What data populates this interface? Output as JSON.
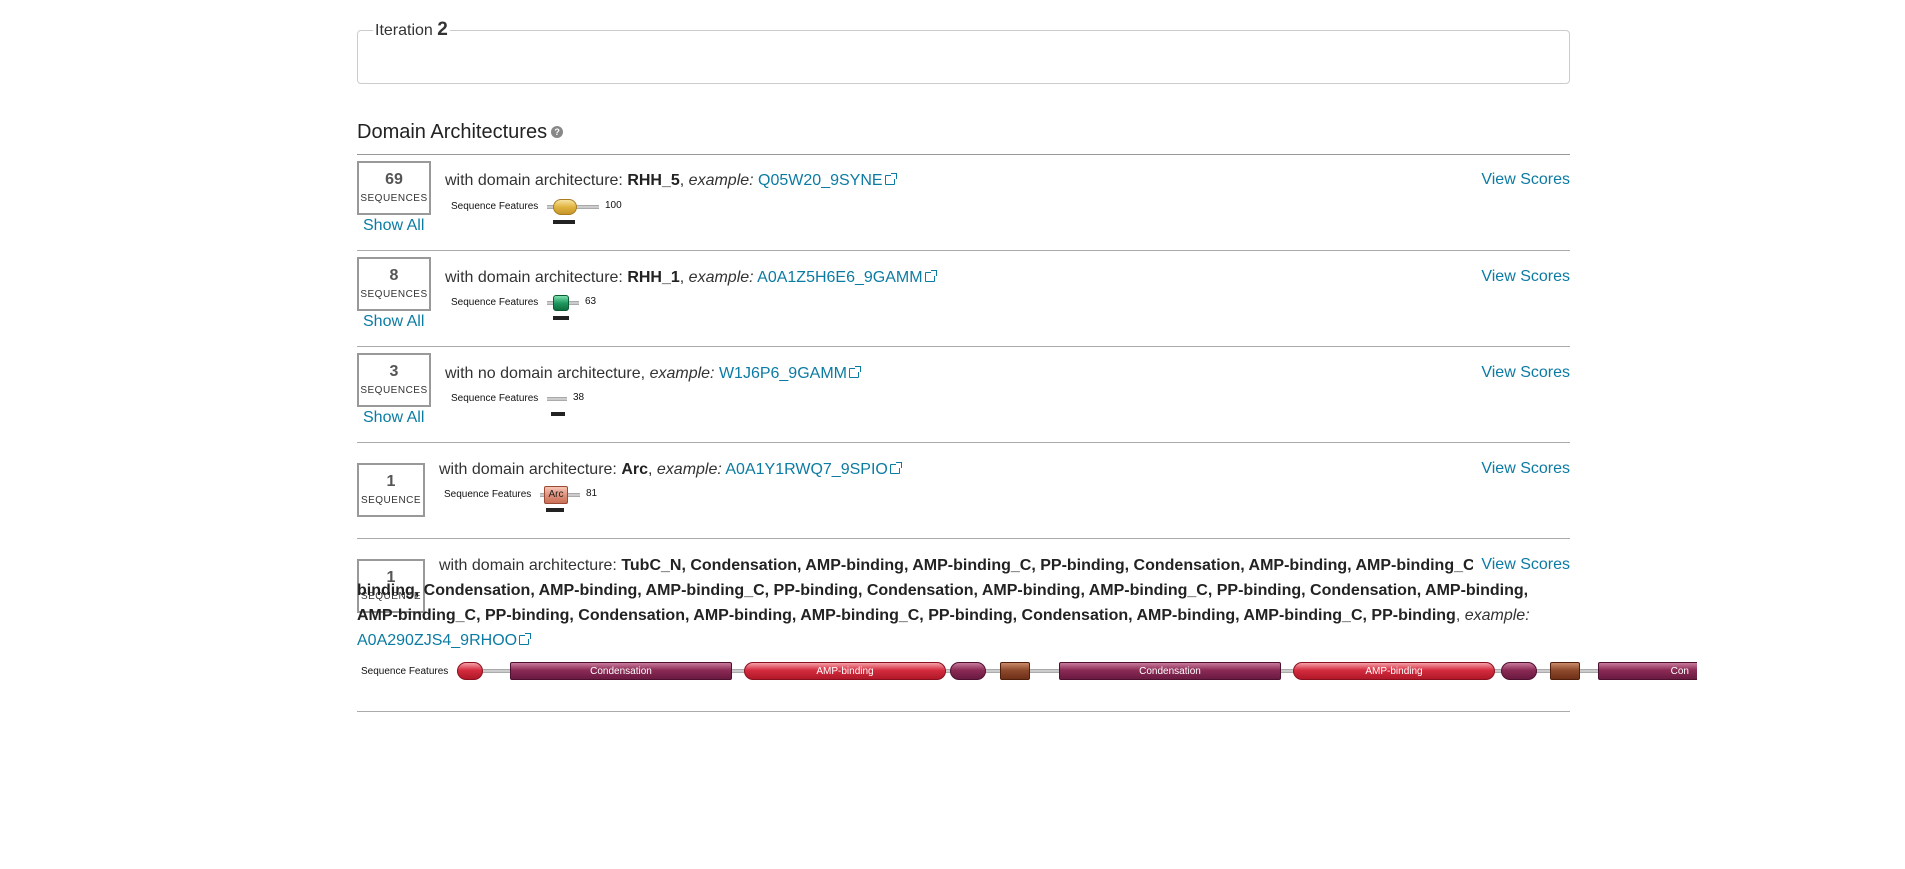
{
  "iteration": {
    "label": "Iteration",
    "number": "2"
  },
  "domain_architectures": {
    "title": "Domain Architectures",
    "help_icon": "question-circle-icon",
    "help_glyph": "?",
    "show_all_label": "Show All",
    "view_scores_label": "View Scores",
    "sequence_features_label": "Sequence Features",
    "example_label": "example:",
    "rows": [
      {
        "count": "69",
        "unit": "SEQUENCES",
        "prefix": "with domain architecture:",
        "arch": "RHH_5",
        "example_id": "Q05W20_9SYNE",
        "length": "100",
        "domain_color": "#e6c15a"
      },
      {
        "count": "8",
        "unit": "SEQUENCES",
        "prefix": "with domain architecture:",
        "arch": "RHH_1",
        "example_id": "A0A1Z5H6E6_9GAMM",
        "length": "63",
        "domain_color": "#1e8f5a"
      },
      {
        "count": "3",
        "unit": "SEQUENCES",
        "prefix": "with no domain architecture,",
        "example_id": "W1J6P6_9GAMM",
        "length": "38"
      },
      {
        "count": "1",
        "unit": "SEQUENCE",
        "prefix": "with domain architecture:",
        "arch": "Arc",
        "example_id": "A0A1Y1RWQ7_9SPIO",
        "length": "81",
        "domain_label": "Arc",
        "domain_color": "#e0a08a"
      },
      {
        "count": "1",
        "unit": "SEQUENCE",
        "prefix": "with domain architecture:",
        "arch": "TubC_N, Condensation, AMP-binding, AMP-binding_C, PP-binding, Condensation, AMP-binding, AMP-binding_C, PP-binding, Condensation, AMP-binding, AMP-binding_C, PP-binding, Condensation, AMP-binding, AMP-binding_C, PP-binding, Condensation, AMP-binding, AMP-binding_C, PP-binding, Condensation, AMP-binding, AMP-binding_C, PP-binding, Condensation, AMP-binding, AMP-binding_C, PP-binding",
        "example_id": "A0A290ZJS4_9RHOO",
        "domains": [
          "",
          "Condensation",
          "AMP-binding",
          "",
          "",
          "Condensation",
          "AMP-binding",
          "",
          "",
          "Con"
        ]
      }
    ]
  },
  "colors": {
    "link": "#0c7ba3",
    "rule": "#999999"
  }
}
